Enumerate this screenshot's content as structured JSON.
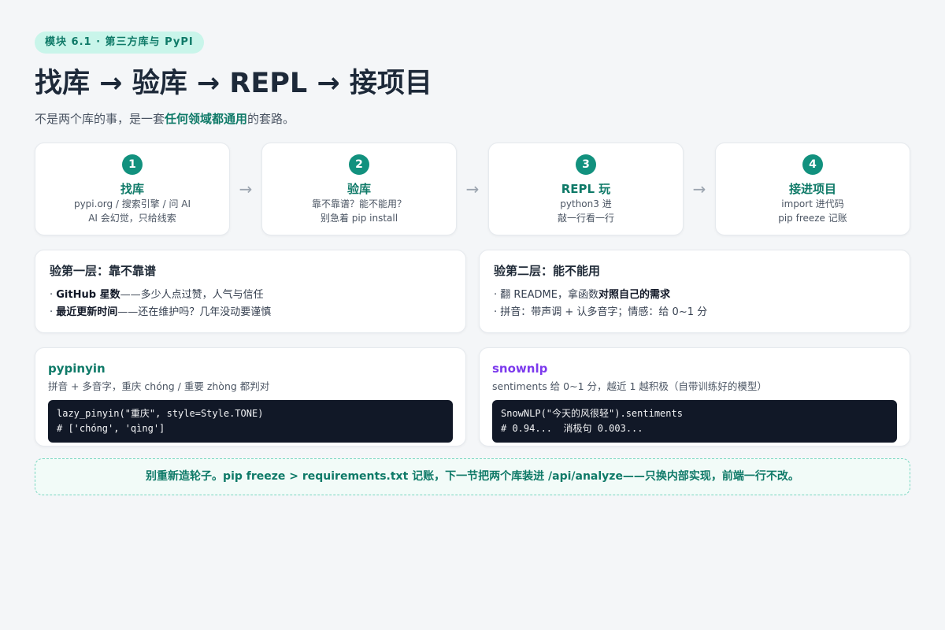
{
  "badge": "模块 6.1 · 第三方库与 PyPI",
  "title": "找库 → 验库 → REPL → 接项目",
  "subtitle": {
    "before": "不是两个库的事，是一套",
    "highlight": "任何领域都通用",
    "after": "的套路。"
  },
  "steps": [
    {
      "num": "1",
      "title": "找库",
      "line1": "pypi.org / 搜索引擎 / 问 AI",
      "line2": "AI 会幻觉，只给线索"
    },
    {
      "num": "2",
      "title": "验库",
      "line1": "靠不靠谱？能不能用？",
      "line2": "别急着 pip install"
    },
    {
      "num": "3",
      "title": "REPL 玩",
      "line1": "python3 进",
      "line2": "敲一行看一行"
    },
    {
      "num": "4",
      "title": "接进项目",
      "line1": "import 进代码",
      "line2": "pip freeze 记账"
    }
  ],
  "arrow_glyph": "→",
  "check1": {
    "title": "验第一层：靠不靠谱",
    "row1": {
      "bold": "GitHub 星数",
      "rest": "——多少人点过赞，人气与信任"
    },
    "row2": {
      "bold": "最近更新时间",
      "rest": "——还在维护吗？几年没动要谨慎"
    }
  },
  "check2": {
    "title": "验第二层：能不能用",
    "row1": {
      "pre": "翻 README，拿函数",
      "bold": "对照自己的需求"
    },
    "row2": {
      "text": "拼音：带声调 + 认多音字；情感：给 0~1 分"
    }
  },
  "lib1": {
    "name": "pypinyin",
    "name_color": "#0f7a68",
    "desc": "拼音 + 多音字，重庆 chóng / 重要 zhòng 都判对",
    "code_line1": "lazy_pinyin(\"重庆\", style=Style.TONE)",
    "code_line2": "# ['chóng', 'qìng']"
  },
  "lib2": {
    "name": "snownlp",
    "name_color": "#7c3aed",
    "desc": "sentiments 给 0~1 分，越近 1 越积极（自带训练好的模型）",
    "code_line1": "SnowNLP(\"今天的风很轻\").sentiments",
    "code_line2": "# 0.94...  消极句 0.003..."
  },
  "footer": "别重新造轮子。pip freeze > requirements.txt 记账，下一节把两个库装进 /api/analyze——只换内部实现，前端一行不改。"
}
